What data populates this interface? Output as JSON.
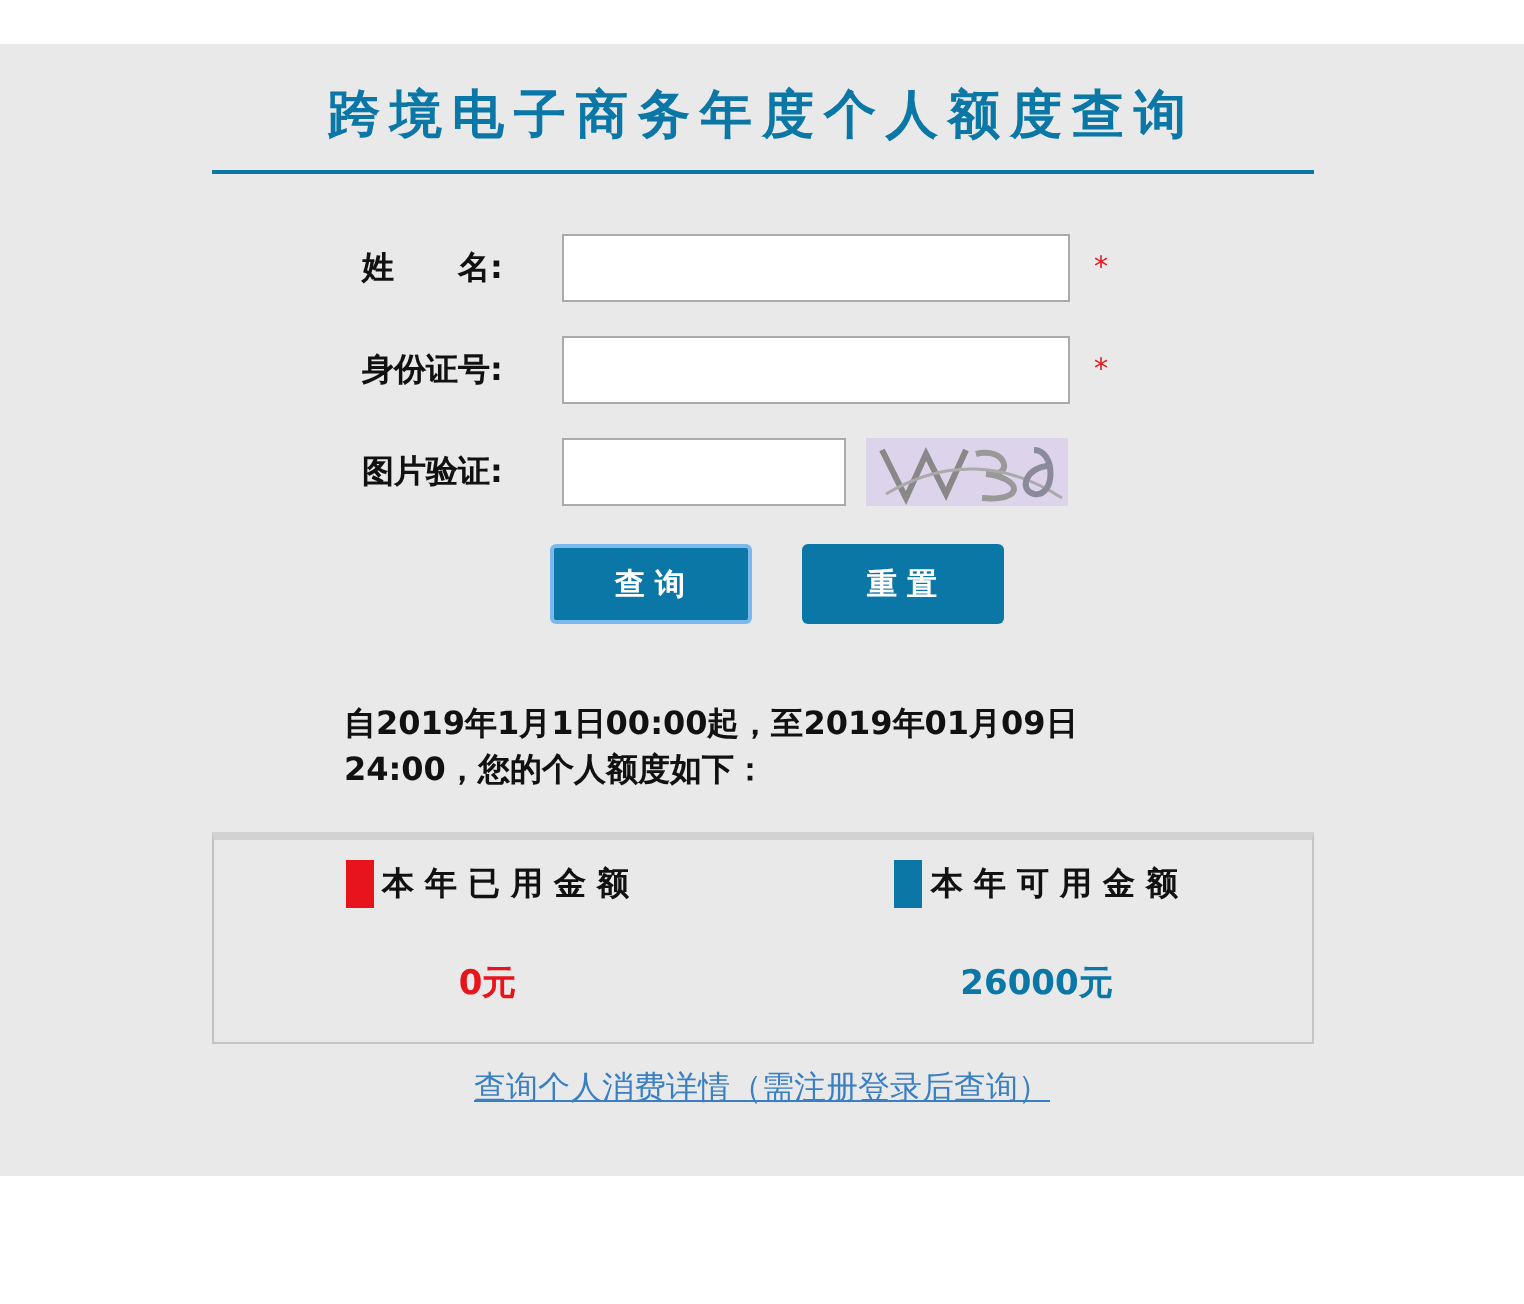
{
  "title": "跨境电子商务年度个人额度查询",
  "fields": [
    {
      "label": "姓　　名:",
      "kind": "text",
      "note": "*"
    },
    {
      "label": "身份证号:",
      "kind": "text",
      "note": "*"
    },
    {
      "label": "图片验证:",
      "kind": "captcha"
    }
  ],
  "buttons": [
    {
      "label": "查 询",
      "focused": true
    },
    {
      "label": "重 置",
      "focused": false
    }
  ],
  "notice": "自2019年1月1日00:00起，至2019年01月09日24:00，您的个人额度如下：",
  "summary": [
    {
      "label": "本 年 已 用 金 额",
      "value": "0元",
      "color": "#e8141b"
    },
    {
      "label": "本 年 可 用 金 额",
      "value": "26000元",
      "color": "#0b77a6"
    }
  ],
  "link": "查询个人消费详情（需注册登录后查询）"
}
